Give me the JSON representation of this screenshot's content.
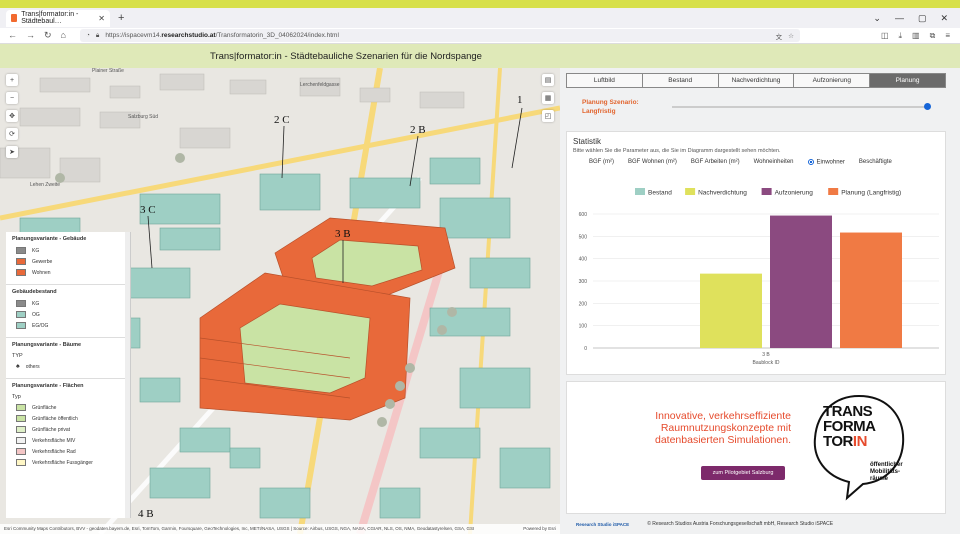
{
  "browser": {
    "tab_title": "Trans|formator:in - Städtebaul…",
    "url_prefix": "https://ispacevm14.",
    "url_domain": "researchstudio.at",
    "url_rest": "/Transformatorin_3D_04062024/index.html"
  },
  "app": {
    "title": "Trans|formator:in - Städtebauliche Szenarien für die Nordspange"
  },
  "map": {
    "labels": [
      "Plainer Straße",
      "Salzburg Süd",
      "Lehen Zweite",
      "Lerchenfeldgasse"
    ],
    "block_labels": [
      "1",
      "2 C",
      "2 B",
      "3 C",
      "3 B",
      "4 B"
    ],
    "attribution": "Esri Community Maps Contributors, BVV - geodaten.bayern.de, Esri, TomTom, Garmin, Foursquare, GeoTechnologies, Inc, METI/NASA, USGS | Source: Airbus, USGS, NGA, NASA, CGIAR, NLS, OS, NMA, Geodatastyrelsen, GSA, GSI",
    "powered_by": "Powered by Esri"
  },
  "legend": {
    "sections": [
      {
        "title": "Planungsvariante - Gebäude",
        "items": [
          {
            "label": "KG",
            "color": "#8a8a8a"
          },
          {
            "label": "Gewerbe",
            "color": "#e8693a"
          },
          {
            "label": "Wohnen",
            "color": "#e8693a"
          }
        ]
      },
      {
        "title": "Gebäudebestand",
        "items": [
          {
            "label": "KG",
            "color": "#8a8a8a"
          },
          {
            "label": "OG",
            "color": "#9ecfc4"
          },
          {
            "label": "EG/OG",
            "color": "#9ecfc4"
          }
        ]
      },
      {
        "title": "Planungsvariante - Bäume",
        "sub": "TYP",
        "items": [
          {
            "label": "others",
            "color": "#555555"
          }
        ]
      },
      {
        "title": "Planungsvariante - Flächen",
        "sub": "Typ",
        "items": [
          {
            "label": "Grünfläche",
            "color": "#c9e3a4"
          },
          {
            "label": "Grünfläche öffentlich",
            "color": "#c9e3a4"
          },
          {
            "label": "Grünfläche privat",
            "color": "#dff0c8"
          },
          {
            "label": "Verkehrsfläche MIV",
            "color": "#f2f2f2"
          },
          {
            "label": "Verkehrsfläche Rad",
            "color": "#f4c6c6"
          },
          {
            "label": "Verkehrsfläche Fussgänger",
            "color": "#fff7c6"
          }
        ]
      }
    ]
  },
  "panel": {
    "tabs": [
      "Luftbild",
      "Bestand",
      "Nachverdichtung",
      "Aufzonierung",
      "Planung"
    ],
    "active_tab": "Planung",
    "scenario_label": "Planung Szenario:",
    "scenario_value": "Langfristig"
  },
  "statistik": {
    "title": "Statistik",
    "hint": "Bitte wählen Sie die Parameter aus, die Sie im Diagramm dargestellt sehen möchten.",
    "options": [
      "BGF (m²)",
      "BGF Wohnen (m²)",
      "BGF Arbeiten (m²)",
      "Wohneinheiten",
      "Einwohner",
      "Beschäftigte"
    ],
    "selected_option": "Einwohner"
  },
  "chart_data": {
    "type": "bar",
    "categories": [
      "3 B"
    ],
    "series": [
      {
        "name": "Bestand",
        "color": "#9ecfc4",
        "values": [
          0
        ]
      },
      {
        "name": "Nachverdichtung",
        "color": "#dfe15c",
        "values": [
          333
        ]
      },
      {
        "name": "Aufzonierung",
        "color": "#8b4a80",
        "values": [
          593
        ]
      },
      {
        "name": "Planung (Langfristig)",
        "color": "#f07a44",
        "values": [
          517
        ]
      }
    ],
    "xlabel": "Baublock ID",
    "ylabel": "",
    "ylim": [
      0,
      600
    ],
    "yticks": [
      0,
      100,
      200,
      300,
      400,
      500,
      600
    ],
    "legend": "top"
  },
  "promo": {
    "text_lines": [
      "Innovative, verkehrseffiziente",
      "Raumnutzungskonzepte mit",
      "datenbasierten Simulationen."
    ],
    "button": "zum Pilotgebiet Salzburg",
    "logo_lines": [
      "TRANS",
      "FORMA",
      "TOR"
    ],
    "logo_in": "IN",
    "logo_sub": [
      "öffentlicher",
      "Mobilitäts-",
      "räume"
    ]
  },
  "footer": {
    "brand": "Research Studio iSPACE",
    "copyright": "© Research Studios Austria Forschungsgesellschaft mbH, Research Studio iSPACE"
  }
}
